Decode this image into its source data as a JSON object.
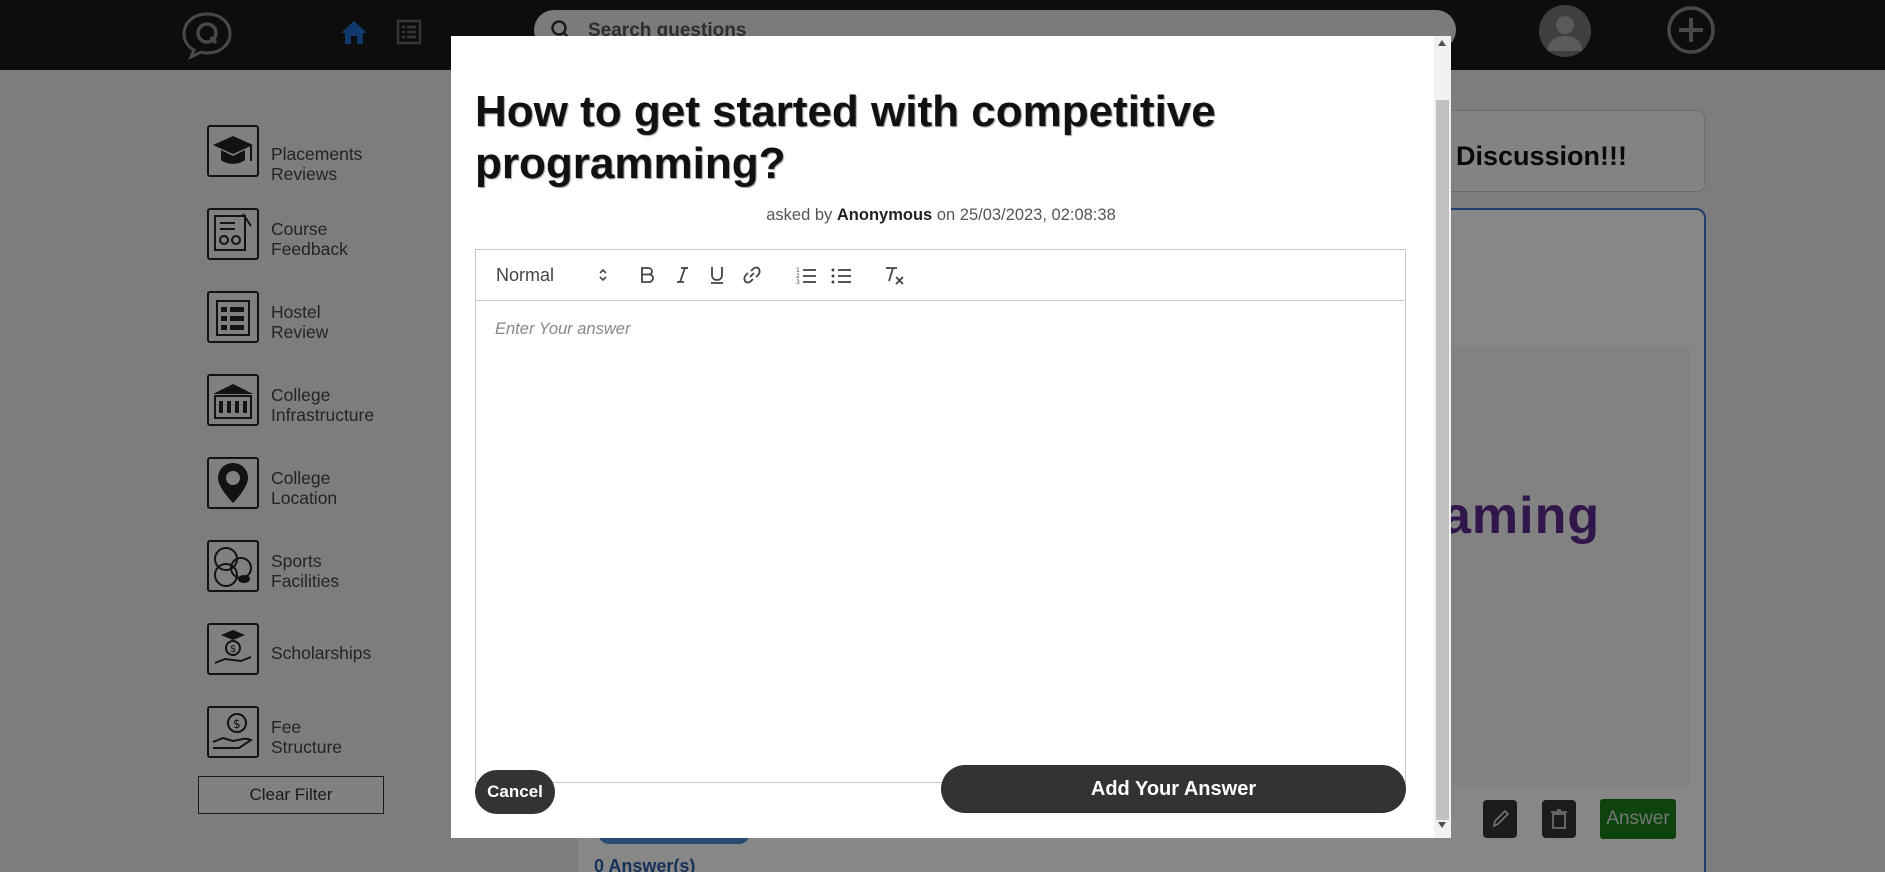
{
  "colors": {
    "navbar": "#1a1a1a",
    "accent_blue": "#3c78c8",
    "answer_green": "#1a7f1a",
    "button_dark": "#333333"
  },
  "navbar": {
    "logo_icon": "q-chat-logo-icon",
    "home_icon": "home-icon",
    "list_icon": "list-icon",
    "search_placeholder": "Search questions",
    "avatar_icon": "user-avatar-icon",
    "add_icon": "plus-circle-icon"
  },
  "sidebar": {
    "items": [
      {
        "line1": "Placements",
        "line2": "Reviews",
        "icon": "graduation-cap-icon"
      },
      {
        "line1": "Course",
        "line2": "Feedback",
        "icon": "feedback-form-icon"
      },
      {
        "line1": "Hostel",
        "line2": "Review",
        "icon": "hostel-building-icon"
      },
      {
        "line1": "College",
        "line2": "Infrastructure",
        "icon": "college-building-icon"
      },
      {
        "line1": "College",
        "line2": "Location",
        "icon": "location-pin-icon"
      },
      {
        "line1": "Sports",
        "line2": "Facilities",
        "icon": "sports-balls-icon"
      },
      {
        "line1": "Scholarships",
        "line2": "",
        "icon": "scholarship-icon"
      },
      {
        "line1": "Fee",
        "line2": "Structure",
        "icon": "fee-hand-icon"
      }
    ],
    "clear_filter": "Clear Filter"
  },
  "main": {
    "banner_text": "Discussion!!!",
    "image_text": "aming",
    "answer_button": "Answer",
    "answers_count": "0 Answer(s)"
  },
  "modal": {
    "title": "How to get started with competitive programming?",
    "meta_prefix": "asked by",
    "author": "Anonymous",
    "meta_on": "on",
    "timestamp": "25/03/2023, 02:08:38",
    "toolbar": {
      "format_value": "Normal"
    },
    "editor_placeholder": "Enter Your answer",
    "cancel": "Cancel",
    "submit": "Add Your Answer"
  }
}
